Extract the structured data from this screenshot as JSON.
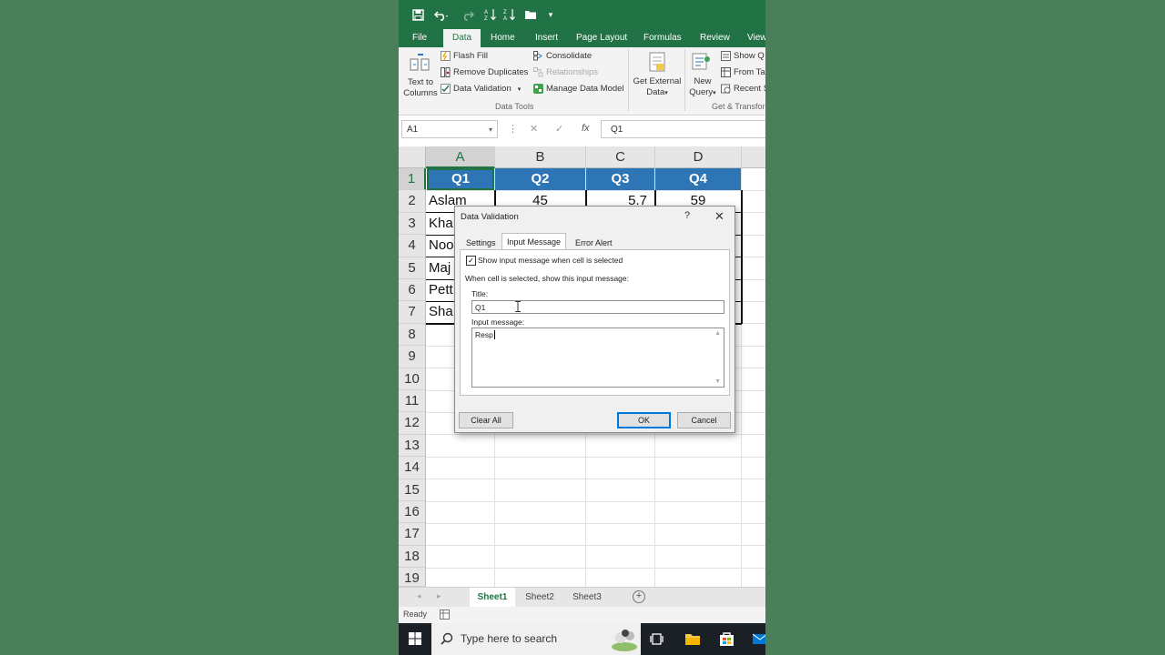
{
  "quick_access": {
    "customize": "▾"
  },
  "ribbon_tabs": [
    "File",
    "Data",
    "Home",
    "Insert",
    "Page Layout",
    "Formulas",
    "Review",
    "View"
  ],
  "active_tab": "Data",
  "ribbon": {
    "text_to_columns": [
      "Text to",
      "Columns"
    ],
    "flash_fill": "Flash Fill",
    "remove_duplicates": "Remove Duplicates",
    "data_validation": "Data Validation",
    "consolidate": "Consolidate",
    "relationships": "Relationships",
    "manage_data_model": "Manage Data Model",
    "data_tools_label": "Data Tools",
    "get_external_data": [
      "Get External",
      "Data"
    ],
    "new_query": [
      "New",
      "Query"
    ],
    "show_queries": "Show Q",
    "from_table": "From Ta",
    "recent_sources": "Recent S",
    "get_transform_label": "Get & Transfor"
  },
  "formula_bar": {
    "name_box": "A1",
    "fx": "fx",
    "value": "Q1"
  },
  "columns": [
    "A",
    "B",
    "C",
    "D"
  ],
  "rows": [
    "1",
    "2",
    "3",
    "4",
    "5",
    "6",
    "7",
    "8",
    "9",
    "10",
    "11",
    "12",
    "13",
    "14",
    "15",
    "16",
    "17",
    "18",
    "19"
  ],
  "table": {
    "headers": [
      "Q1",
      "Q2",
      "Q3",
      "Q4"
    ],
    "row2": [
      "Aslam",
      "45",
      "5.7",
      "59"
    ],
    "names": [
      "Kha",
      "Noo",
      "Maj",
      "Pett",
      "Sha"
    ]
  },
  "sheets": [
    "Sheet1",
    "Sheet2",
    "Sheet3"
  ],
  "active_sheet": "Sheet1",
  "status": "Ready",
  "taskbar": {
    "search_placeholder": "Type here to search"
  },
  "dialog": {
    "title": "Data Validation",
    "help": "?",
    "close": "✕",
    "tabs": [
      "Settings",
      "Input Message",
      "Error Alert"
    ],
    "active_tab": "Input Message",
    "show_checkbox_label": "Show input message when cell is selected",
    "show_checked": true,
    "instruction": "When cell is selected, show this input message:",
    "title_label": "Title:",
    "title_value": "Q1",
    "message_label": "Input message:",
    "message_value": "Resp",
    "buttons": {
      "clear_all": "Clear All",
      "ok": "OK",
      "cancel": "Cancel"
    }
  },
  "colors": {
    "excel_green": "#217346",
    "header_blue": "#2e75b6",
    "background": "#4a7f5a"
  }
}
